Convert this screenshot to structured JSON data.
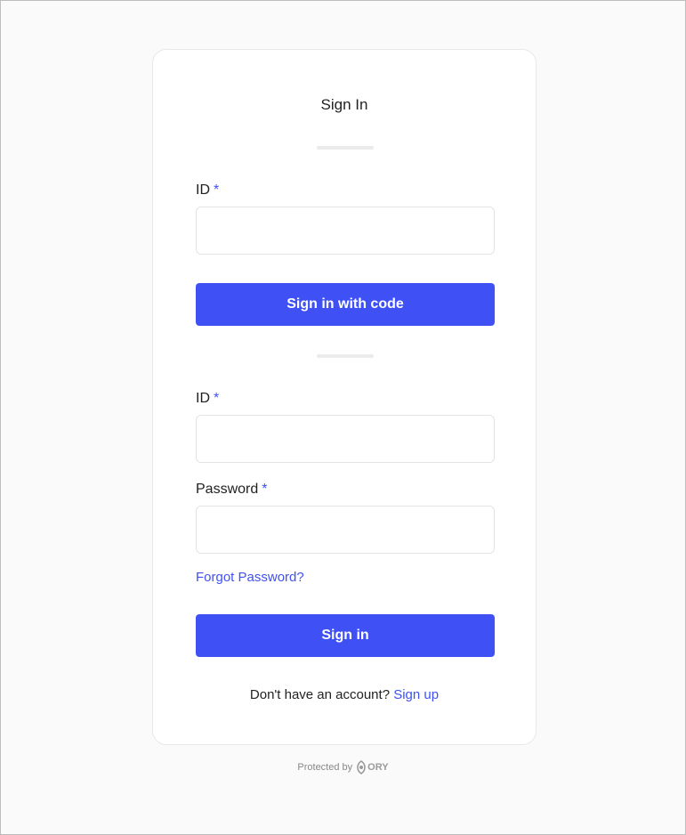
{
  "card": {
    "title": "Sign In",
    "code_section": {
      "id_label": "ID",
      "required_marker": "*",
      "id_value": "",
      "submit_label": "Sign in with code"
    },
    "password_section": {
      "id_label": "ID",
      "password_label": "Password",
      "required_marker": "*",
      "id_value": "",
      "password_value": "",
      "forgot_label": "Forgot Password?",
      "submit_label": "Sign in"
    },
    "signup_prompt": "Don't have an account?",
    "signup_link": "Sign up"
  },
  "footer": {
    "protected_by": "Protected by",
    "brand": "ORY",
    "brand_icon": "ory-logo-icon"
  },
  "colors": {
    "accent": "#3f51f5",
    "background": "#fafafa",
    "card": "#ffffff"
  }
}
